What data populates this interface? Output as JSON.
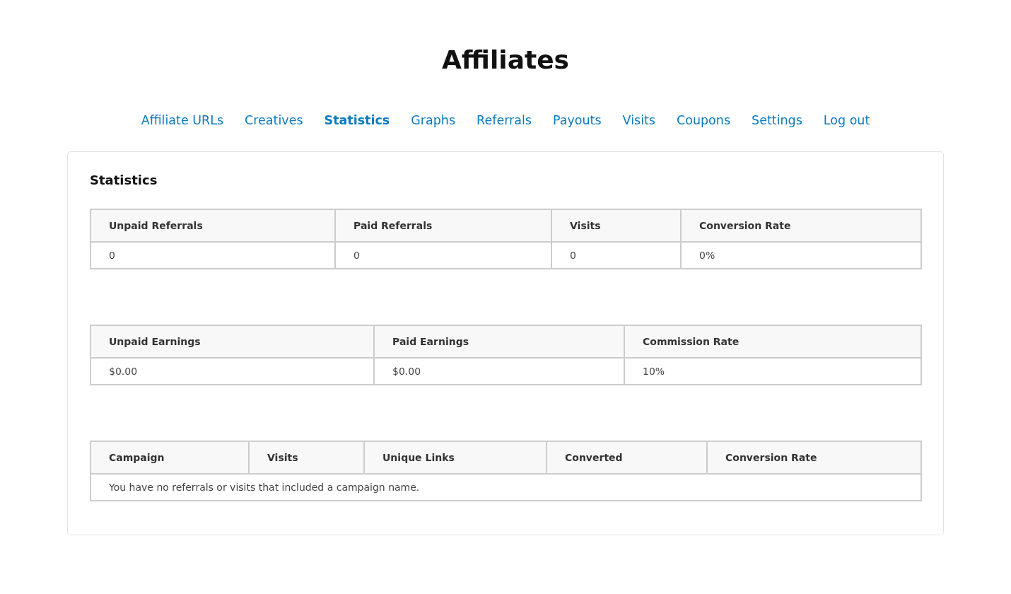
{
  "page_title": "Affiliates",
  "nav": [
    {
      "label": "Affiliate URLs",
      "selected": false
    },
    {
      "label": "Creatives",
      "selected": false
    },
    {
      "label": "Statistics",
      "selected": true
    },
    {
      "label": "Graphs",
      "selected": false
    },
    {
      "label": "Referrals",
      "selected": false
    },
    {
      "label": "Payouts",
      "selected": false
    },
    {
      "label": "Visits",
      "selected": false
    },
    {
      "label": "Coupons",
      "selected": false
    },
    {
      "label": "Settings",
      "selected": false
    },
    {
      "label": "Log out",
      "selected": false
    }
  ],
  "section_title": "Statistics",
  "tables": [
    {
      "columns": [
        "Unpaid Referrals",
        "Paid Referrals",
        "Visits",
        "Conversion Rate"
      ],
      "rows": [
        [
          "0",
          "0",
          "0",
          "0%"
        ]
      ]
    },
    {
      "columns": [
        "Unpaid Earnings",
        "Paid Earnings",
        "Commission Rate"
      ],
      "rows": [
        [
          "$0.00",
          "$0.00",
          "10%"
        ]
      ]
    },
    {
      "columns": [
        "Campaign",
        "Visits",
        "Unique Links",
        "Converted",
        "Conversion Rate"
      ],
      "empty_message": "You have no referrals or visits that included a campaign name."
    }
  ]
}
